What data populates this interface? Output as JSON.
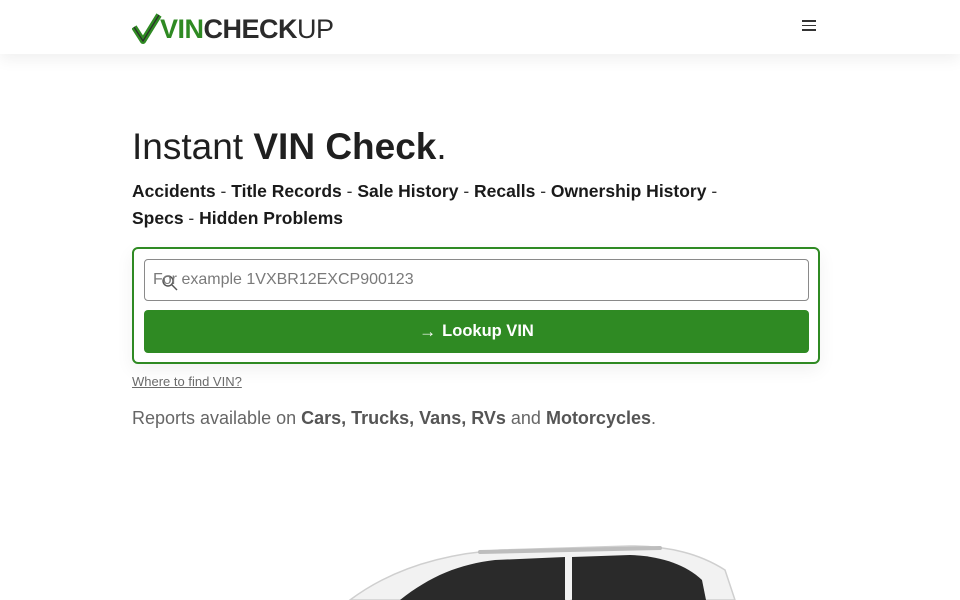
{
  "header": {
    "logo": {
      "vin": "VIN",
      "check": "CHECK",
      "up": "UP"
    },
    "menu_icon": "hamburger-menu-icon"
  },
  "hero": {
    "title_light": "Instant ",
    "title_bold": "VIN Check",
    "title_end": ".",
    "features": [
      "Accidents",
      "Title Records",
      "Sale History",
      "Recalls",
      "Ownership History",
      "Specs",
      "Hidden Problems"
    ],
    "separator": " - "
  },
  "search": {
    "placeholder": "For example 1VXBR12EXCP900123",
    "value": "",
    "button_arrow": "→",
    "button_label": "Lookup VIN",
    "icon": "search-icon"
  },
  "help_link": "Where to find VIN?",
  "reports": {
    "prefix": "Reports available on ",
    "types": "Cars, Trucks, Vans, RVs",
    "and": " and ",
    "last": "Motorcycles",
    "end": "."
  },
  "colors": {
    "brand_green": "#2f8a23",
    "text_dark": "#1a1a1a",
    "muted": "#666666"
  }
}
